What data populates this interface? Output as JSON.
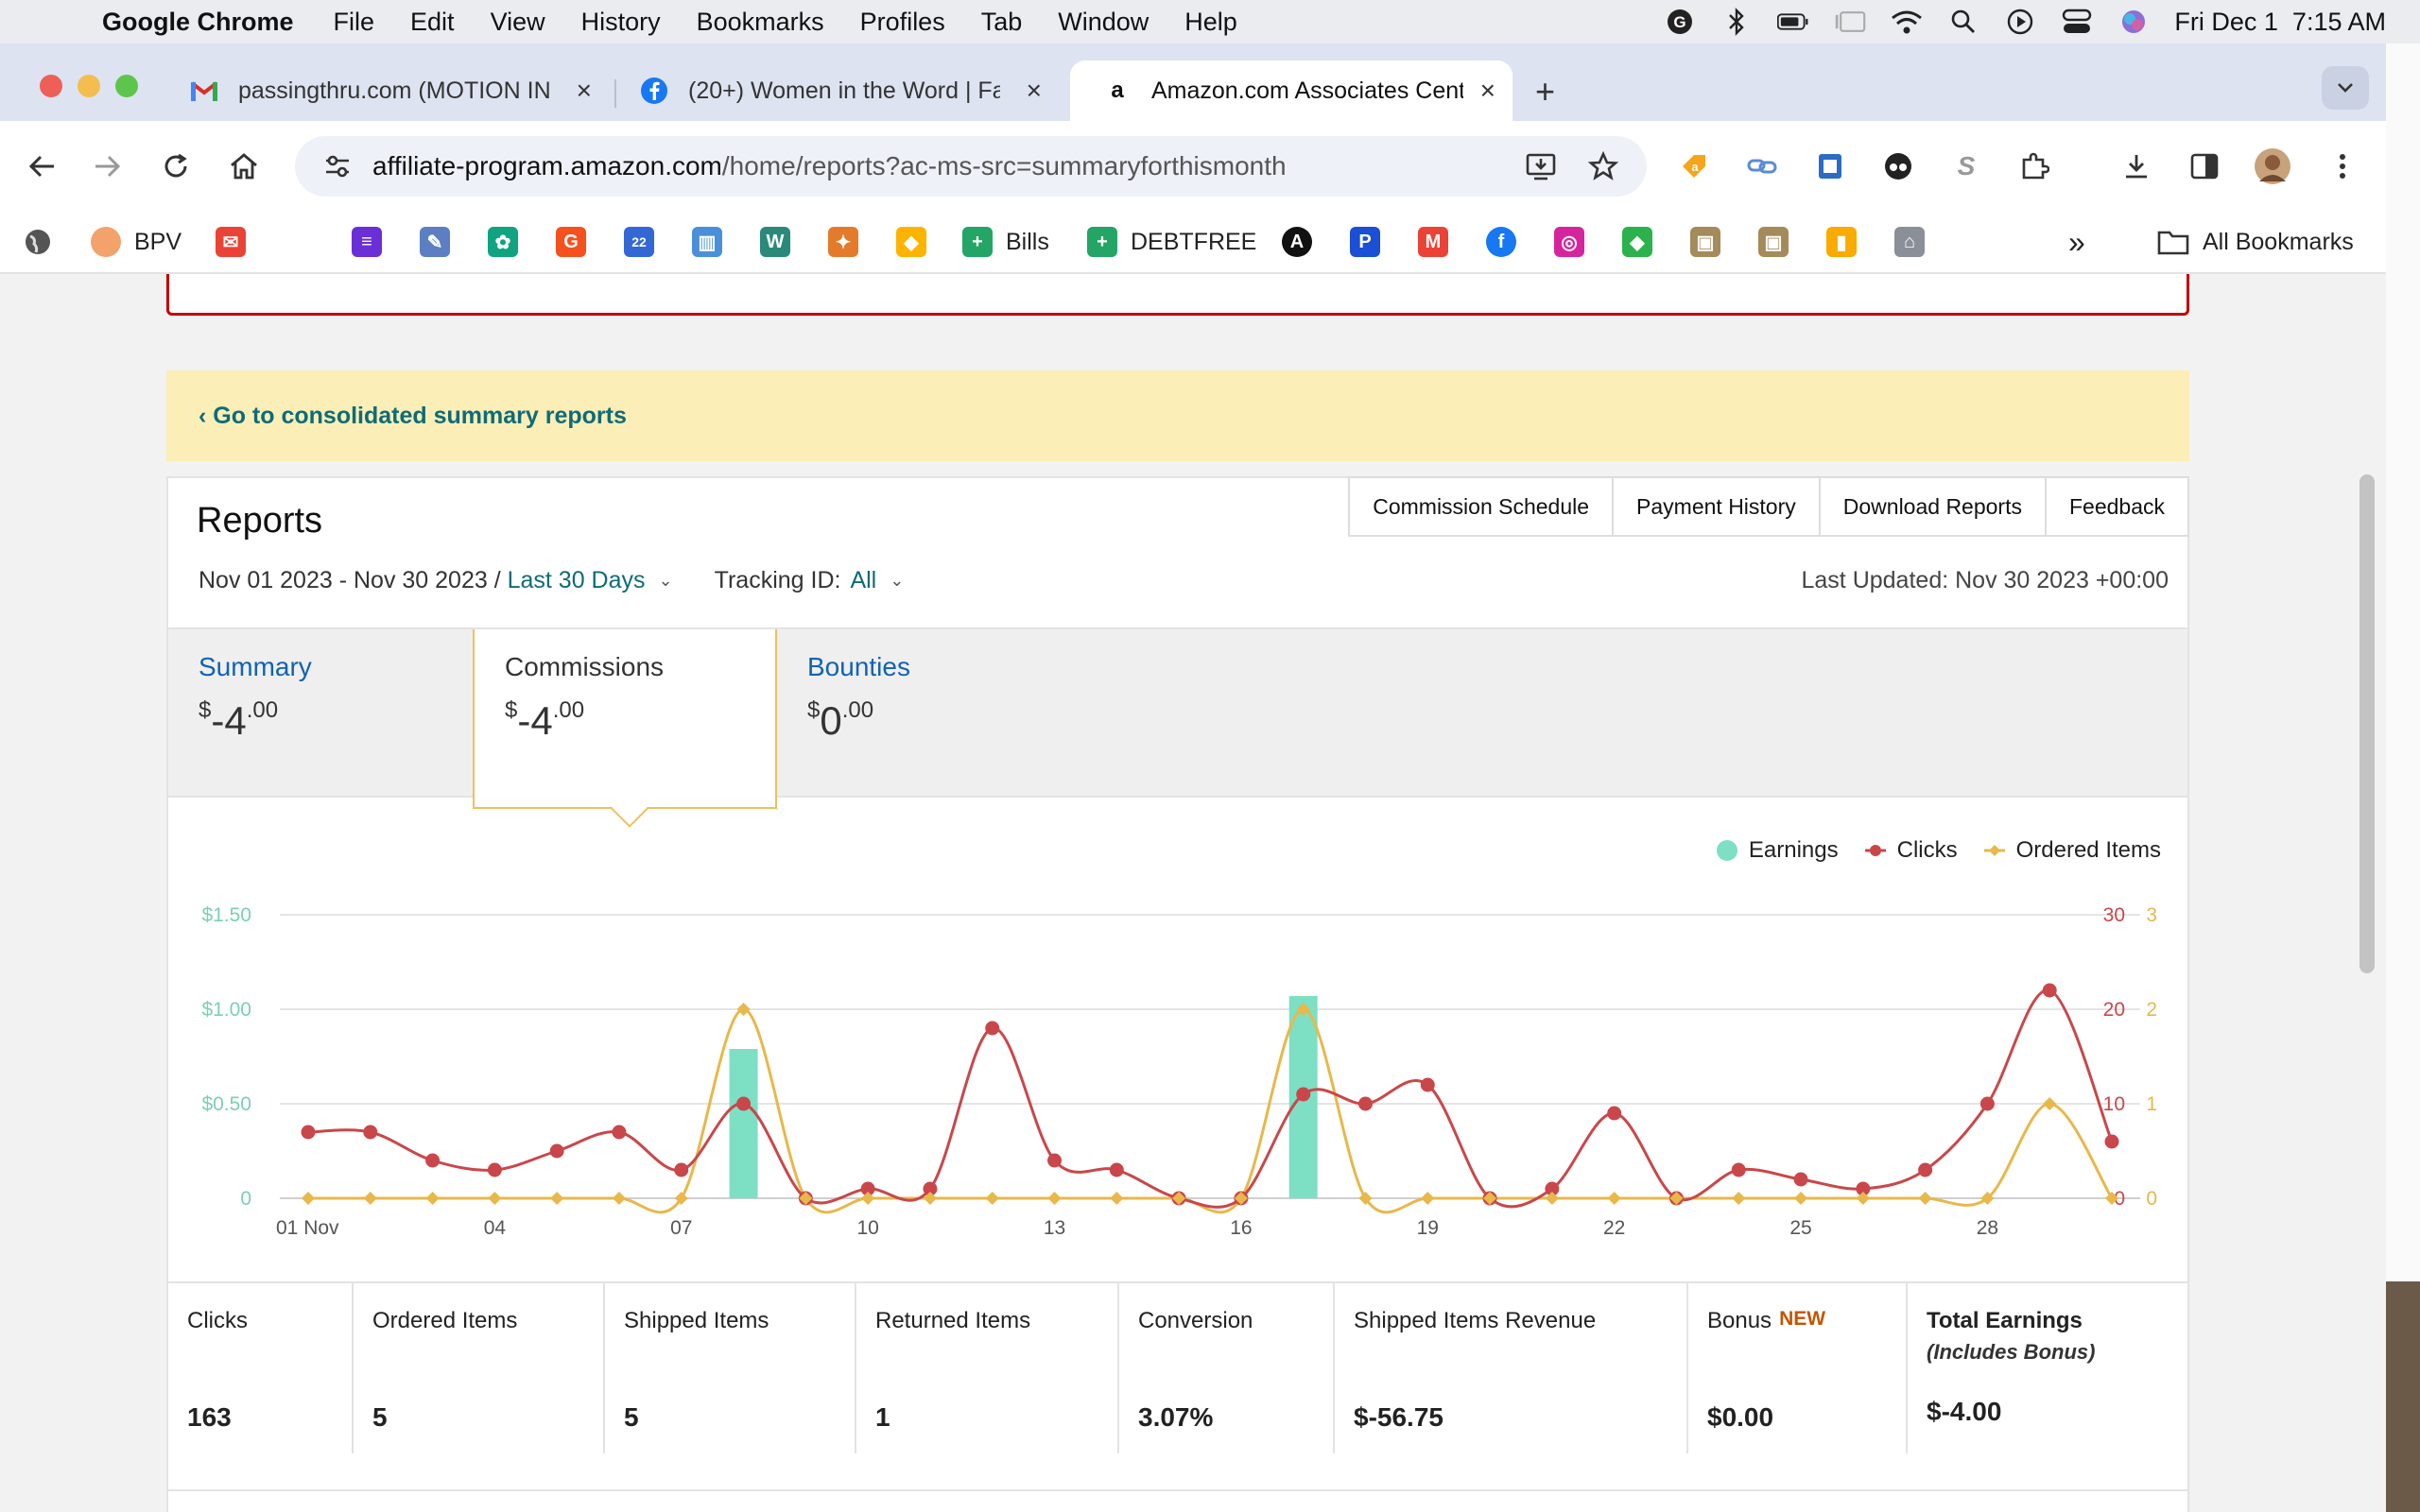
{
  "menubar": {
    "app": "Google Chrome",
    "items": [
      "File",
      "Edit",
      "View",
      "History",
      "Bookmarks",
      "Profiles",
      "Tab",
      "Window",
      "Help"
    ],
    "datetime": "Fri Dec 1  7:15 AM"
  },
  "tabs": [
    {
      "title": "passingthru.com (MOTION IN",
      "icon": "gmail-icon"
    },
    {
      "title": "(20+) Women in the Word | Fa",
      "icon": "facebook-icon"
    },
    {
      "title": "Amazon.com Associates Cent",
      "icon": "amazon-icon"
    }
  ],
  "omnibox": {
    "host": "affiliate-program.amazon.com",
    "path": "/home/reports?ac-ms-src=summaryforthismonth"
  },
  "bookmarks": {
    "bpv": "BPV",
    "bills": "Bills",
    "debtfree": "DEBTFREE",
    "all": "All Bookmarks"
  },
  "page": {
    "banner_link": "‹ Go to consolidated summary reports",
    "title": "Reports",
    "links": [
      "Commission Schedule",
      "Payment History",
      "Download Reports",
      "Feedback"
    ],
    "date_range": "Nov 01 2023 - Nov 30 2023",
    "date_sep": " / ",
    "period": "Last 30 Days",
    "tracking_label": "Tracking ID:",
    "tracking_value": "All",
    "last_updated": "Last Updated: Nov 30 2023 +00:00",
    "report_tabs": [
      {
        "label": "Summary",
        "currency": "$",
        "whole": "-4",
        "cents": ".00"
      },
      {
        "label": "Commissions",
        "currency": "$",
        "whole": "-4",
        "cents": ".00"
      },
      {
        "label": "Bounties",
        "currency": "$",
        "whole": "0",
        "cents": ".00"
      }
    ],
    "stats": [
      {
        "label": "Clicks",
        "value": "163"
      },
      {
        "label": "Ordered Items",
        "value": "5"
      },
      {
        "label": "Shipped Items",
        "value": "5"
      },
      {
        "label": "Returned Items",
        "value": "1"
      },
      {
        "label": "Conversion",
        "value": "3.07%"
      },
      {
        "label": "Shipped Items Revenue",
        "value": "$-56.75"
      },
      {
        "label": "Bonus",
        "badge": "NEW",
        "value": "$0.00"
      },
      {
        "label": "Total Earnings",
        "sub": "(Includes Bonus)",
        "value": "$-4.00"
      }
    ]
  },
  "colors": {
    "earnings": "#7ddfc3",
    "clicks": "#c9474a",
    "ordered": "#e8b84a",
    "teal_link": "#0e6b78"
  },
  "chart_data": {
    "type": "bar+line",
    "x": [
      "01 Nov",
      "02",
      "03",
      "04",
      "05",
      "06",
      "07",
      "08",
      "09",
      "10",
      "11",
      "12",
      "13",
      "14",
      "15",
      "16",
      "17",
      "18",
      "19",
      "20",
      "21",
      "22",
      "23",
      "24",
      "25",
      "26",
      "27",
      "28",
      "29",
      "30"
    ],
    "xticks": [
      "01 Nov",
      "04",
      "07",
      "10",
      "13",
      "16",
      "19",
      "22",
      "25",
      "28"
    ],
    "legend": [
      "Earnings",
      "Clicks",
      "Ordered Items"
    ],
    "legend_position": "top-right",
    "axes": {
      "earnings": {
        "ticks": [
          "0",
          "$0.50",
          "$1.00",
          "$1.50"
        ],
        "range": [
          0,
          1.5
        ]
      },
      "clicks": {
        "ticks": [
          "0",
          "10",
          "20",
          "30"
        ],
        "range": [
          0,
          30
        ]
      },
      "ordered": {
        "ticks": [
          "0",
          "1",
          "2",
          "3"
        ],
        "range": [
          0,
          3
        ]
      }
    },
    "series": [
      {
        "name": "Earnings",
        "kind": "bar",
        "values": [
          0,
          0,
          0,
          0,
          0,
          0,
          0,
          0.79,
          0,
          0,
          0,
          0,
          0,
          0,
          0,
          0,
          1.07,
          0,
          0,
          0,
          0,
          0,
          0,
          0,
          0,
          0,
          0,
          0,
          0,
          0
        ]
      },
      {
        "name": "Clicks",
        "kind": "line",
        "values": [
          7,
          7,
          4,
          3,
          5,
          7,
          3,
          10,
          0,
          1,
          1,
          18,
          4,
          3,
          0,
          0,
          11,
          10,
          12,
          0,
          1,
          9,
          0,
          3,
          2,
          1,
          3,
          10,
          22,
          6
        ]
      },
      {
        "name": "Ordered Items",
        "kind": "line",
        "values": [
          0,
          0,
          0,
          0,
          0,
          0,
          0,
          2,
          0,
          0,
          0,
          0,
          0,
          0,
          0,
          0,
          2,
          0,
          0,
          0,
          0,
          0,
          0,
          0,
          0,
          0,
          0,
          0,
          1,
          0
        ]
      }
    ]
  }
}
